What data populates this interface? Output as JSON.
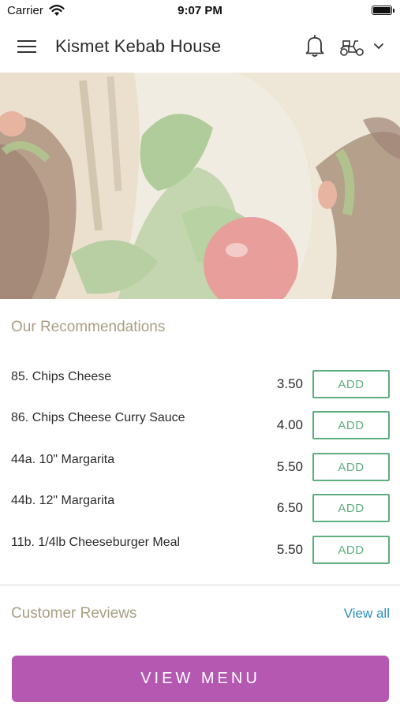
{
  "status_bar": {
    "carrier": "Carrier",
    "time": "9:07 PM"
  },
  "header": {
    "title": "Kismet Kebab House",
    "icons": [
      "menu-icon",
      "bell-icon",
      "scooter-icon",
      "chevron-down-icon"
    ]
  },
  "recommendations": {
    "title": "Our Recommendations",
    "add_label": "ADD",
    "items": [
      {
        "name": "85. Chips Cheese",
        "price": "3.50"
      },
      {
        "name": "86. Chips Cheese Curry Sauce",
        "price": "4.00"
      },
      {
        "name": "44a. 10\" Margarita",
        "price": "5.50"
      },
      {
        "name": "44b. 12\" Margarita",
        "price": "6.50"
      },
      {
        "name": "11b. 1/4lb Cheeseburger Meal",
        "price": "5.50"
      }
    ]
  },
  "reviews": {
    "title": "Customer Reviews",
    "view_all": "View all"
  },
  "cta": {
    "label": "VIEW MENU"
  },
  "colors": {
    "accent_purple": "#b558b2",
    "add_green": "#5fae7e",
    "section_title": "#a89e82",
    "link_blue": "#2a8fbf"
  }
}
